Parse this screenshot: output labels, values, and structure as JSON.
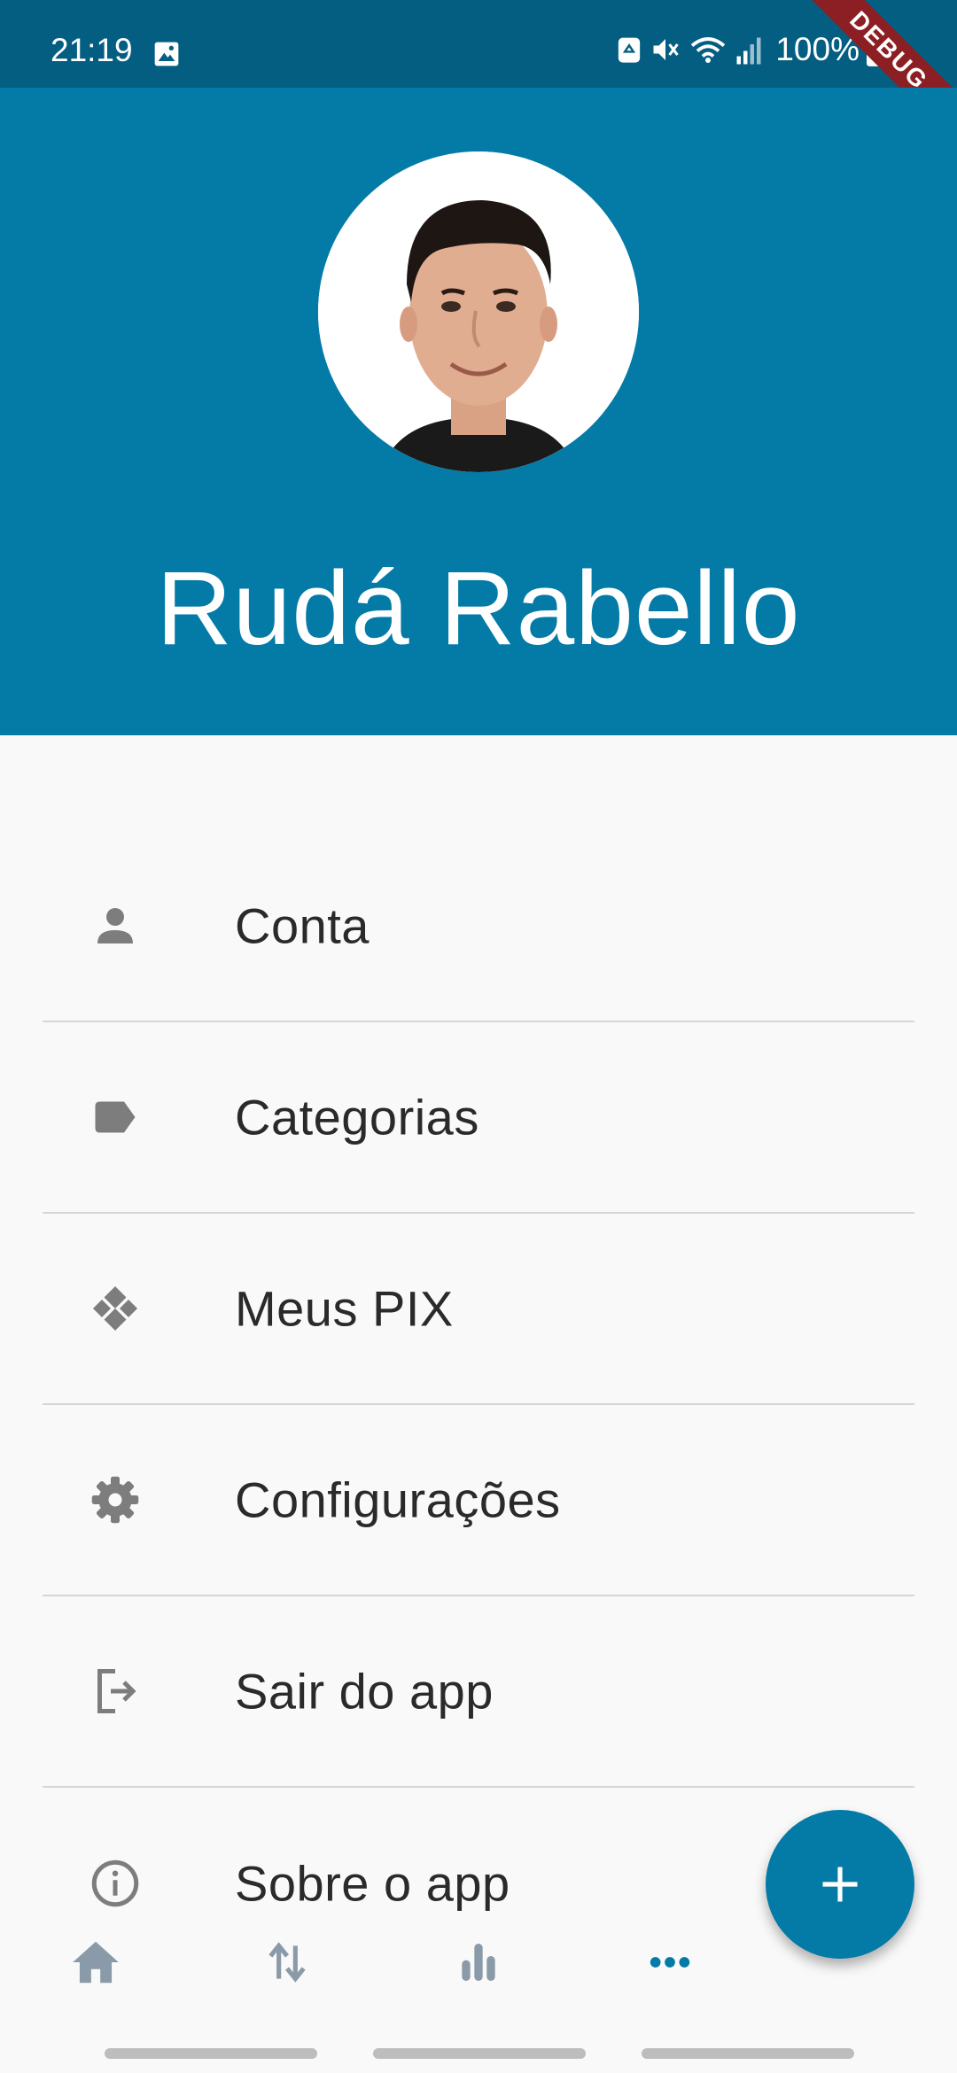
{
  "status_bar": {
    "time": "21:19",
    "battery": "100%",
    "icons": [
      "gallery-icon",
      "recycle-icon",
      "mute-icon",
      "wifi-icon",
      "signal-icon",
      "battery-icon"
    ]
  },
  "debug_banner": "DEBUG",
  "profile": {
    "name": "Rudá Rabello",
    "avatar": "profile-photo"
  },
  "menu": {
    "items": [
      {
        "label": "Conta",
        "icon": "person-icon"
      },
      {
        "label": "Categorias",
        "icon": "label-tag-icon"
      },
      {
        "label": "Meus PIX",
        "icon": "pix-icon"
      },
      {
        "label": "Configurações",
        "icon": "gear-icon"
      },
      {
        "label": "Sair do app",
        "icon": "logout-icon"
      },
      {
        "label": "Sobre o app",
        "icon": "info-icon"
      }
    ]
  },
  "fab": {
    "icon": "plus-icon"
  },
  "bottom_nav": {
    "items": [
      {
        "icon": "home-icon",
        "active": false
      },
      {
        "icon": "transfer-icon",
        "active": false
      },
      {
        "icon": "bar-chart-icon",
        "active": false
      },
      {
        "icon": "more-icon",
        "active": true
      }
    ]
  },
  "colors": {
    "primary": "#047aa7",
    "status_bar": "#045e82",
    "background": "#f9f9f9",
    "icon_gray": "#7d7d7d",
    "debug": "#8b1f23"
  }
}
